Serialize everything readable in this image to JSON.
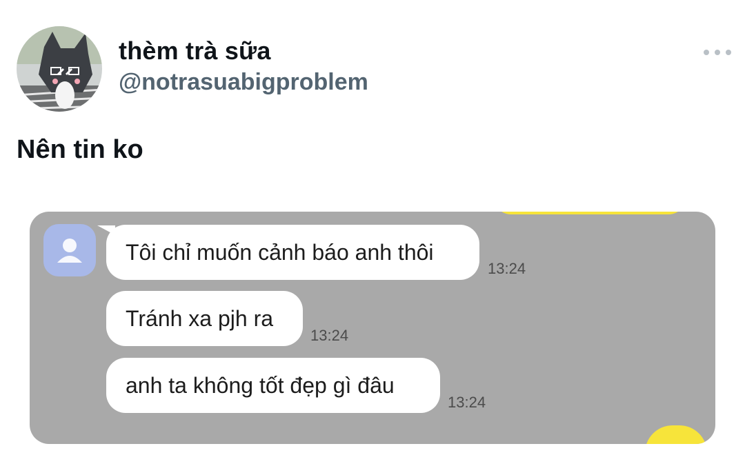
{
  "tweet": {
    "display_name": "thèm trà sữa",
    "handle": "@notrasuabigproblem",
    "text": "Nên tin ko",
    "more_icon": "more-horizontal-icon"
  },
  "chat": {
    "messages": [
      {
        "text": "Tôi chỉ muốn cảnh báo anh thôi",
        "time": "13:24"
      },
      {
        "text": "Tránh xa pjh ra",
        "time": "13:24"
      },
      {
        "text": "anh ta không tốt đẹp gì đâu",
        "time": "13:24"
      }
    ],
    "colors": {
      "background": "#a9a9a9",
      "bubble": "#ffffff",
      "accent_yellow": "#f7e43a",
      "avatar": "#a8b8e8"
    }
  }
}
